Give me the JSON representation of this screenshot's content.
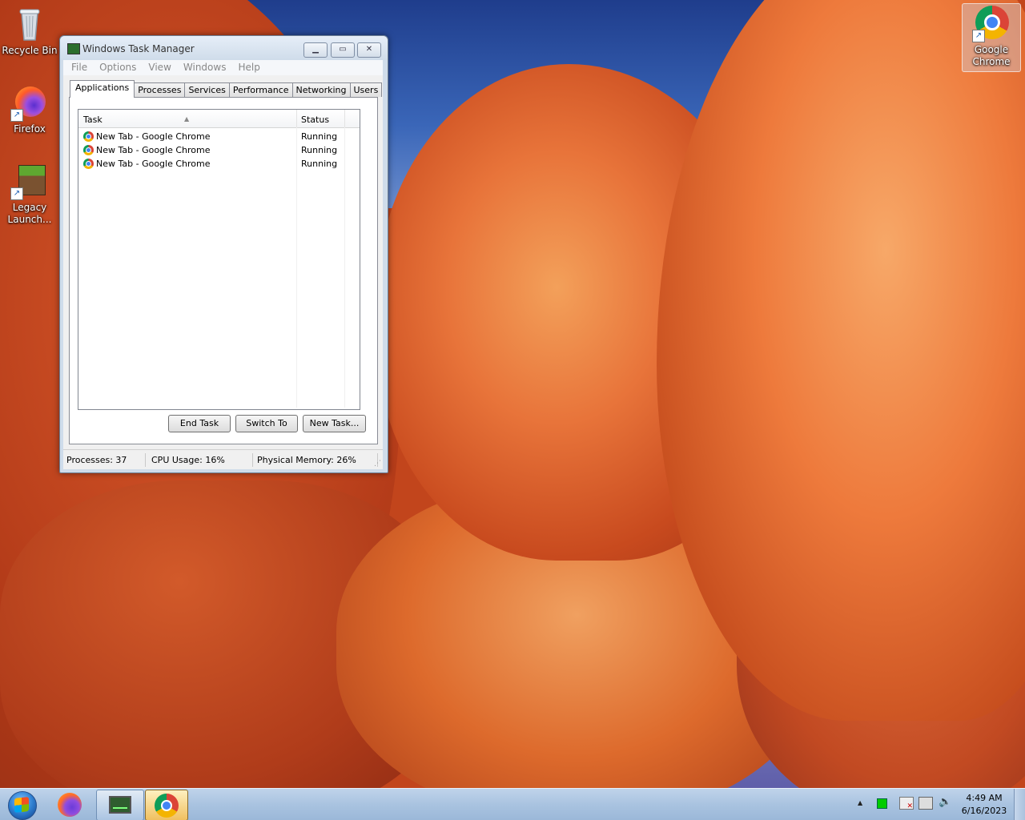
{
  "desktop": {
    "icons": [
      {
        "label": "Recycle Bin"
      },
      {
        "label": "Firefox"
      },
      {
        "label": "Legacy Launch..."
      },
      {
        "label": "Google Chrome"
      }
    ]
  },
  "task_manager": {
    "title": "Windows Task Manager",
    "menu": [
      "File",
      "Options",
      "View",
      "Windows",
      "Help"
    ],
    "tabs": [
      "Applications",
      "Processes",
      "Services",
      "Performance",
      "Networking",
      "Users"
    ],
    "active_tab": "Applications",
    "columns": {
      "task": "Task",
      "status": "Status"
    },
    "rows": [
      {
        "task": "New Tab - Google Chrome",
        "status": "Running"
      },
      {
        "task": "New Tab - Google Chrome",
        "status": "Running"
      },
      {
        "task": "New Tab - Google Chrome",
        "status": "Running"
      }
    ],
    "buttons": {
      "end_task": "End Task",
      "switch_to": "Switch To",
      "new_task": "New Task..."
    },
    "statusbar": {
      "processes": "Processes: 37",
      "cpu": "CPU Usage: 16%",
      "memory": "Physical Memory: 26%"
    }
  },
  "taskbar": {
    "clock_time": "4:49 AM",
    "clock_date": "6/16/2023",
    "tray_arrow": "▲"
  }
}
